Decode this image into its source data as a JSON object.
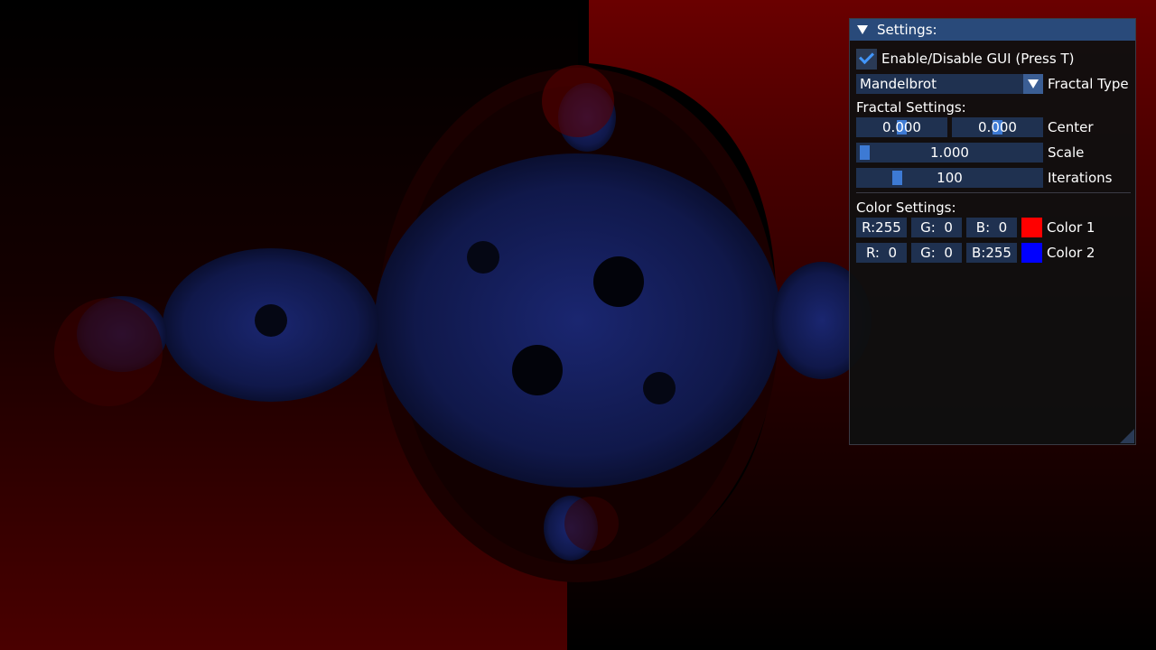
{
  "settings_window": {
    "title": "Settings:",
    "enable_gui_label": "Enable/Disable GUI (Press T)",
    "enable_gui_checked": true,
    "fractal_type": {
      "selected": "Mandelbrot",
      "label": "Fractal Type"
    },
    "fractal_settings": {
      "header": "Fractal Settings:",
      "center_x": "0.000",
      "center_y": "0.000",
      "center_label": "Center",
      "scale": "1.000",
      "scale_label": "Scale",
      "iterations": "100",
      "iterations_label": "Iterations"
    },
    "color_settings": {
      "header": "Color Settings:",
      "color1": {
        "r": "R:255",
        "g": "G:  0",
        "b": "B:  0",
        "label": "Color 1",
        "swatch": "#ff0000"
      },
      "color2": {
        "r": "R:  0",
        "g": "G:  0",
        "b": "B:255",
        "label": "Color 2",
        "swatch": "#0000ff"
      }
    }
  },
  "colors": {
    "accent": "#4296fa",
    "title_bar": "#294a7a",
    "fractal_outer": "#ff0000",
    "fractal_inner": "#0000ff"
  }
}
